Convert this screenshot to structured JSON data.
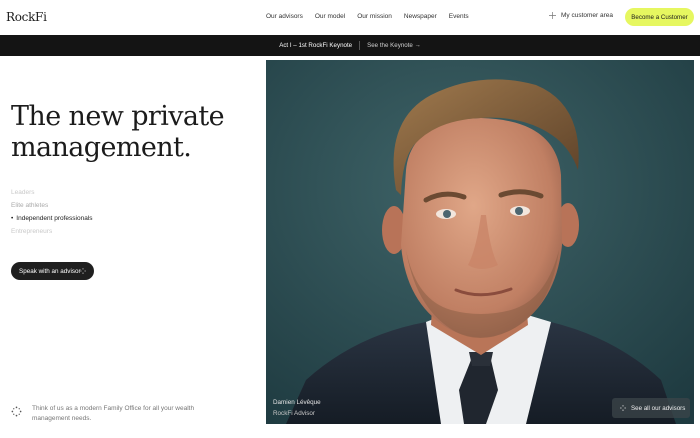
{
  "header": {
    "logo": "RockFi",
    "nav": [
      "Our advisors",
      "Our model",
      "Our mission",
      "Newspaper",
      "Events"
    ],
    "customer_area": "My customer area",
    "cta": "Become a Customer"
  },
  "announcement": {
    "title": "Act I – 1st RockFi Keynote",
    "link": "See the Keynote →"
  },
  "hero": {
    "headline_line1": "The new private",
    "headline_line2": "management.",
    "audiences": [
      "Leaders",
      "Elite athletes",
      "Independent professionals",
      "Entrepreneurs"
    ],
    "active_audience": "Independent professionals",
    "speak_button": "Speak with an advisor",
    "note": "Think of us as a modern Family Office for all your wealth management needs."
  },
  "advisor": {
    "name": "Damien Lévêque",
    "role": "RockFi Advisor",
    "see_all": "See all our advisors"
  },
  "colors": {
    "accent": "#e6f760",
    "dark": "#141414",
    "photo_bg": "#2d4c52"
  },
  "icons": {
    "customer_area": "sparkle-icon",
    "speak": "sparkle-icon",
    "note": "dots-cluster-icon",
    "see_all": "sparkle-icon"
  }
}
